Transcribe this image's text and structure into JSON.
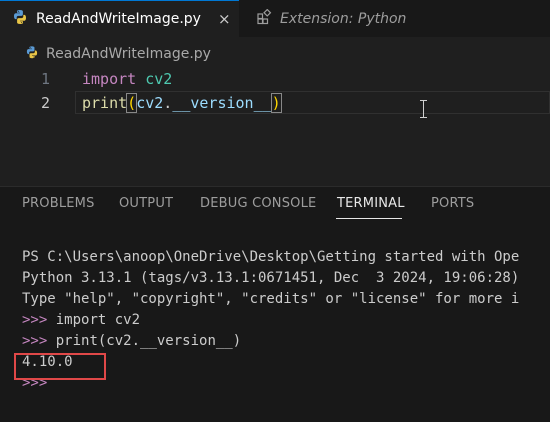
{
  "tabs": [
    {
      "label": "ReadAndWriteImage.py",
      "close": "×",
      "icon": "python-icon"
    },
    {
      "label": "Extension: Python",
      "icon": "extensions-icon"
    }
  ],
  "breadcrumb": {
    "file": "ReadAndWriteImage.py"
  },
  "editor": {
    "lines": [
      {
        "number": "1",
        "kw": "import",
        "module": "cv2"
      },
      {
        "number": "2",
        "fn": "print",
        "open": "(",
        "obj": "cv2",
        "dot": ".",
        "attr": "__version__",
        "close": ")"
      }
    ]
  },
  "panel": {
    "tabs": [
      "PROBLEMS",
      "OUTPUT",
      "DEBUG CONSOLE",
      "TERMINAL",
      "PORTS"
    ],
    "active_tab": "TERMINAL"
  },
  "terminal": {
    "lines": [
      "PS C:\\Users\\anoop\\OneDrive\\Desktop\\Getting started with Ope",
      "Python 3.13.1 (tags/v3.13.1:0671451, Dec  3 2024, 19:06:28)",
      "Type \"help\", \"copyright\", \"credits\" or \"license\" for more i"
    ],
    "prompt": ">>>",
    "cmd1": " import cv2",
    "cmd2": " print(cv2.__version__)",
    "result": "4.10.0",
    "highlight_color": "#e04848"
  },
  "colors": {
    "keyword": "#c586c0",
    "module": "#4ec9b0",
    "function": "#dcdcaa",
    "variable": "#9cdcfe",
    "bracket": "#ffd700",
    "accent": "#0078d4"
  }
}
